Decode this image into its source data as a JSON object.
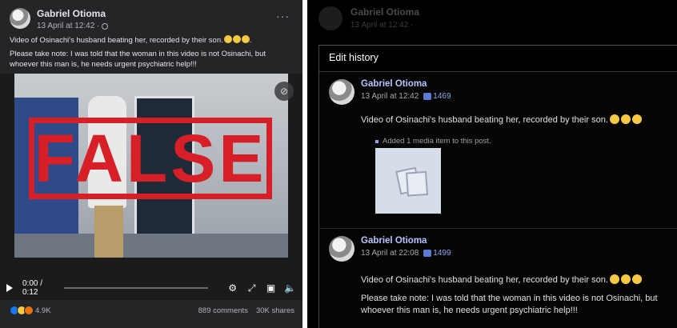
{
  "post": {
    "author": "Gabriel Otioma",
    "time": "13 April at 12:42 · ",
    "more": "···",
    "text1": "Video of Osinachi's husband beating her, recorded by their son.",
    "text2": "Please take note: I was told that the woman in this video is not Osinachi, but whoever this man is, he needs urgent psychiatric help!!!",
    "overlay_label": "FALSE",
    "video": {
      "current_time": "0:00",
      "duration": "0:12",
      "separator": " / ",
      "progress": 0.0
    },
    "reactions_count": "4.9K",
    "comments": "889 comments",
    "shares": "30K shares"
  },
  "modal": {
    "bg_author": "Gabriel Otioma",
    "bg_time": "13 April at 12:42 ·",
    "title": "Edit history",
    "entries": [
      {
        "author": "Gabriel Otioma",
        "time": "13 April at 12:42",
        "likes": "1469",
        "text": "Video of Osinachi's husband beating her, recorded by their son.",
        "note": "Added 1 media item to this post."
      },
      {
        "author": "Gabriel Otioma",
        "time": "13 April at 22:08",
        "likes": "1499",
        "text": "Video of Osinachi's husband beating her, recorded by their son.",
        "text2": "Please take note: I was told that the woman in this video is not Osinachi, but whoever this man is, he needs urgent psychiatric help!!!"
      }
    ]
  },
  "colors": {
    "false_red": "#d61f26",
    "link_blue": "#b8c4ff",
    "facebook_blue": "#1877f2"
  },
  "icons": [
    "globe-icon",
    "more-icon",
    "eye-slash-icon",
    "play-icon",
    "settings-icon",
    "fullscreen-icon",
    "pip-icon",
    "volume-icon",
    "like-icon",
    "sad-icon",
    "angry-icon",
    "thumb-icon",
    "media-placeholder-icon"
  ]
}
